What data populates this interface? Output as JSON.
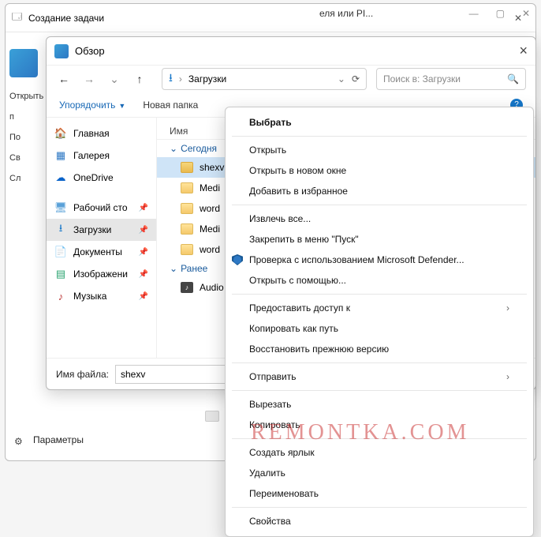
{
  "parent": {
    "title": "Создание задачи",
    "tab_hint": "еля или PI...",
    "left_labels": [
      "Открыть",
      "п",
      "По",
      "Св",
      "Сл"
    ],
    "params": "Параметры"
  },
  "dialog": {
    "title": "Обзор",
    "breadcrumb": "Загрузки",
    "search_placeholder": "Поиск в: Загрузки",
    "organize": "Упорядочить",
    "new_folder": "Новая папка",
    "tree": [
      {
        "label": "Главная",
        "ico": "home"
      },
      {
        "label": "Галерея",
        "ico": "gal"
      },
      {
        "label": "OneDrive",
        "ico": "od"
      },
      {
        "label": "Рабочий сто",
        "ico": "desk",
        "pin": true
      },
      {
        "label": "Загрузки",
        "ico": "dl",
        "pin": true,
        "sel": true
      },
      {
        "label": "Документы",
        "ico": "doc",
        "pin": true
      },
      {
        "label": "Изображени",
        "ico": "img",
        "pin": true
      },
      {
        "label": "Музыка",
        "ico": "mus",
        "pin": true
      }
    ],
    "col_name": "Имя",
    "groups": [
      {
        "label": "Сегодня",
        "rows": [
          {
            "name": "shexv",
            "ico": "zip",
            "sel": true
          },
          {
            "name": "Medi",
            "ico": "fld"
          },
          {
            "name": "word",
            "ico": "fld"
          },
          {
            "name": "Medi",
            "ico": "fld"
          },
          {
            "name": "word",
            "ico": "fld"
          }
        ]
      },
      {
        "label": "Ранее",
        "rows": [
          {
            "name": "Audio",
            "ico": "aud"
          }
        ]
      }
    ],
    "filename_label": "Имя файла:",
    "filename_value": "shexv"
  },
  "context_menu": {
    "items": [
      {
        "label": "Выбрать",
        "bold": true
      },
      {
        "sep": true
      },
      {
        "label": "Открыть"
      },
      {
        "label": "Открыть в новом окне"
      },
      {
        "label": "Добавить в избранное"
      },
      {
        "sep": true
      },
      {
        "label": "Извлечь все..."
      },
      {
        "label": "Закрепить в меню \"Пуск\""
      },
      {
        "label": "Проверка с использованием Microsoft Defender...",
        "shield": true
      },
      {
        "label": "Открыть с помощью..."
      },
      {
        "sep": true
      },
      {
        "label": "Предоставить доступ к",
        "sub": true
      },
      {
        "label": "Копировать как путь"
      },
      {
        "label": "Восстановить прежнюю версию"
      },
      {
        "sep": true
      },
      {
        "label": "Отправить",
        "sub": true
      },
      {
        "sep": true
      },
      {
        "label": "Вырезать"
      },
      {
        "label": "Копировать"
      },
      {
        "sep": true
      },
      {
        "label": "Создать ярлык"
      },
      {
        "label": "Удалить"
      },
      {
        "label": "Переименовать"
      },
      {
        "sep": true
      },
      {
        "label": "Свойства"
      }
    ]
  },
  "watermark": "REMONTKA.COM"
}
